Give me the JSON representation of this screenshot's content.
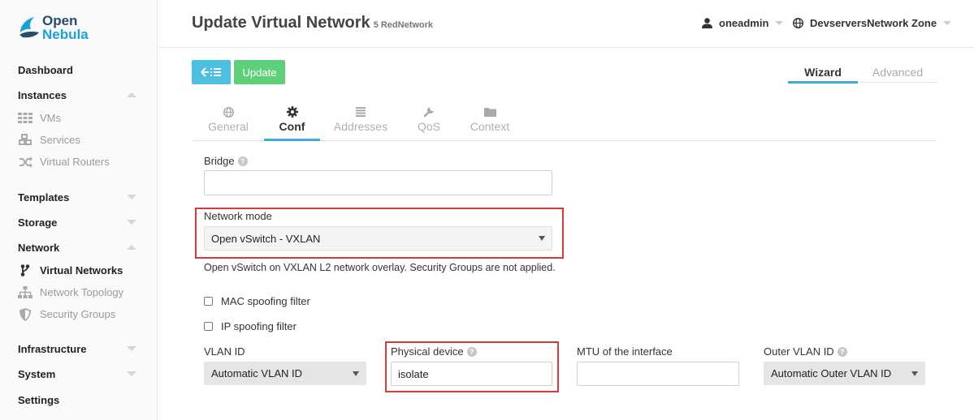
{
  "brand": {
    "line1": "Open",
    "line2": "Nebula"
  },
  "sidebar": {
    "dashboard": "Dashboard",
    "instances": "Instances",
    "vms": "VMs",
    "services": "Services",
    "virtual_routers": "Virtual Routers",
    "templates": "Templates",
    "storage": "Storage",
    "network": "Network",
    "virtual_networks": "Virtual Networks",
    "network_topology": "Network Topology",
    "security_groups": "Security Groups",
    "infrastructure": "Infrastructure",
    "system": "System",
    "settings": "Settings"
  },
  "header": {
    "title": "Update Virtual Network",
    "subtitle": "5 RedNetwork",
    "user": "oneadmin",
    "zone": "DevserversNetwork Zone"
  },
  "toolbar": {
    "update_label": "Update"
  },
  "modes": {
    "wizard": "Wizard",
    "advanced": "Advanced"
  },
  "tabs": {
    "general": "General",
    "conf": "Conf",
    "addresses": "Addresses",
    "qos": "QoS",
    "context": "Context"
  },
  "form": {
    "bridge_label": "Bridge",
    "bridge_value": "",
    "network_mode_label": "Network mode",
    "network_mode_value": "Open vSwitch - VXLAN",
    "network_mode_desc": "Open vSwitch on VXLAN L2 network overlay. Security Groups are not applied.",
    "mac_spoofing": "MAC spoofing filter",
    "ip_spoofing": "IP spoofing filter",
    "vlan_id_label": "VLAN ID",
    "vlan_id_value": "Automatic VLAN ID",
    "physical_device_label": "Physical device",
    "physical_device_value": "isolate",
    "mtu_label": "MTU of the interface",
    "mtu_value": "",
    "outer_vlan_label": "Outer VLAN ID",
    "outer_vlan_value": "Automatic Outer VLAN ID"
  },
  "colors": {
    "accent": "#3aaed8",
    "update_button": "#5fd07a",
    "highlight": "#d9393b"
  }
}
